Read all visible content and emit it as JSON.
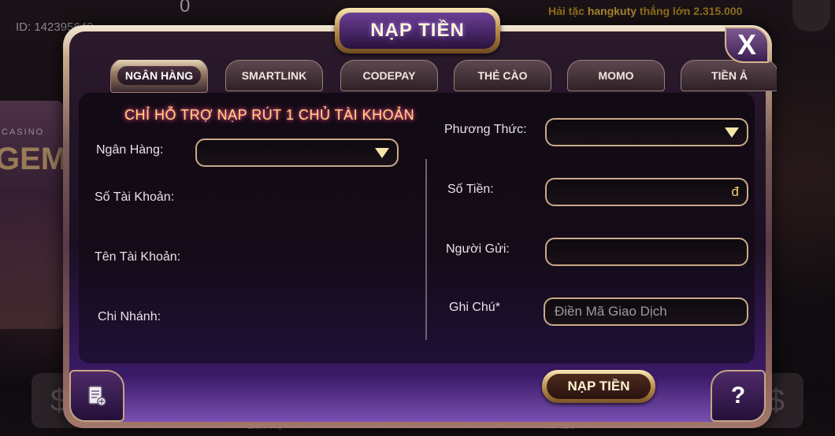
{
  "background": {
    "player_id": "ID: 142395648",
    "balance": "0",
    "ticker_prefix": "Hải tặc",
    "ticker_user": "hangkuty",
    "ticker_suffix": "thắng lớn 2.315.000",
    "casino_label": "CASINO",
    "casino_logo": "GEM",
    "bottom_label_1": "Liên Hệ",
    "bottom_label_2": "Tin tức"
  },
  "dialog": {
    "title": "NẠP TIỀN",
    "close_label": "X",
    "tabs": [
      {
        "label": "NGÂN HÀNG",
        "active": true
      },
      {
        "label": "SMARTLINK",
        "active": false
      },
      {
        "label": "CODEPAY",
        "active": false
      },
      {
        "label": "THẺ CÀO",
        "active": false
      },
      {
        "label": "MOMO",
        "active": false
      },
      {
        "label": "TIỀN Ả",
        "active": false
      }
    ],
    "notice": "CHỈ HỖ TRỢ NẠP RÚT 1 CHỦ TÀI KHOẢN",
    "left": {
      "bank_label": "Ngân Hàng:",
      "bank_value": "",
      "account_number_label": "Số Tài Khoản:",
      "account_name_label": "Tên Tài Khoản:",
      "branch_label": "Chi Nhánh:"
    },
    "right": {
      "method_label": "Phương Thức:",
      "method_value": "",
      "amount_label": "Số Tiền:",
      "amount_value": "",
      "currency_symbol": "đ",
      "sender_label": "Người Gửi:",
      "sender_value": "",
      "note_label": "Ghi Chú*",
      "note_placeholder": "Điền Mã Giao Dịch"
    },
    "submit_label": "NẠP TIỀN",
    "help_label": "?"
  },
  "colors": {
    "accent_gold": "#f3cf6b",
    "notice_glow": "#ff5fa2",
    "panel_bg": "#120a14"
  }
}
